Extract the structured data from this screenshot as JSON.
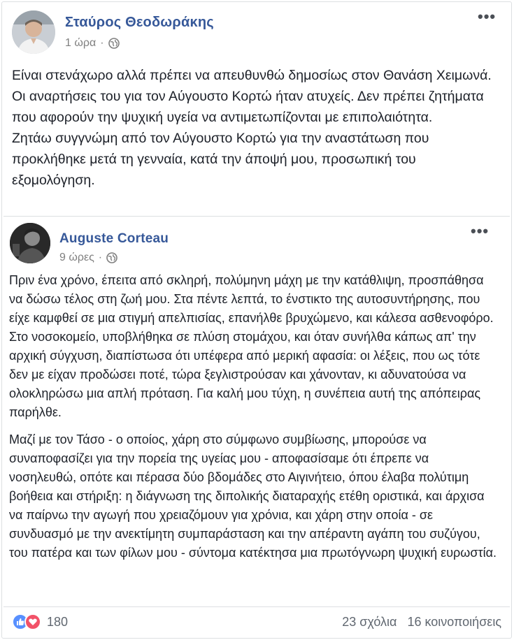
{
  "outer_post": {
    "author": "Σταύρος Θεοδωράκης",
    "time": "1 ώρα",
    "paragraphs": [
      "Είναι στενάχωρο αλλά πρέπει να απευθυνθώ δημοσίως στον Θανάση Χειμωνά. Οι αναρτήσεις του για τον Αύγουστο Κορτώ ήταν ατυχείς. Δεν πρέπει ζητήματα που αφορούν την ψυχική υγεία να αντιμετωπίζονται με επιπολαιότητα.",
      "Ζητάω συγγνώμη από τον Αύγουστο Κορτώ για την αναστάτωση που προκλήθηκε μετά τη γενναία, κατά την άποψή μου, προσωπική του εξομολόγηση."
    ]
  },
  "shared_post": {
    "author": "Auguste Corteau",
    "time": "9 ώρες",
    "paragraphs": [
      "Πριν ένα χρόνο, έπειτα από σκληρή, πολύμηνη μάχη με την κατάθλιψη, προσπάθησα να δώσω τέλος στη ζωή μου. Στα πέντε λεπτά, το ένστικτο της αυτοσυντήρησης, που είχε καμφθεί σε μια στιγμή απελπισίας, επανήλθε βρυχώμενο, και κάλεσα ασθενοφόρο. Στο νοσοκομείο, υποβλήθηκα σε πλύση στομάχου, και όταν συνήλθα κάπως απ' την αρχική σύγχυση, διαπίστωσα ότι υπέφερα από μερική αφασία: οι λέξεις, που ως τότε δεν με είχαν προδώσει ποτέ, τώρα ξεγλιστρούσαν και χάνονταν, κι αδυνατούσα να ολοκληρώσω μια απλή πρόταση. Για καλή μου τύχη, η συνέπεια αυτή της απόπειρας παρήλθε.",
      "Μαζί με τον Τάσο - ο οποίος, χάρη στο σύμφωνο συμβίωσης, μπορούσε να συναποφασίζει για την πορεία της υγείας μου - αποφασίσαμε ότι έπρεπε να νοσηλευθώ, οπότε και πέρασα δύο βδομάδες στο Αιγινήτειο, όπου έλαβα πολύτιμη βοήθεια και στήριξη: η διάγνωση της διπολικής διαταραχής ετέθη οριστικά, και άρχισα να παίρνω την αγωγή που χρειαζόμουν για χρόνια, και χάρη στην οποία - σε συνδυασμό με την ανεκτίμητη συμπαράσταση και την απέραντη αγάπη του συζύγου, του πατέρα και των φίλων μου - σύντομα κατέκτησα μια πρωτόγνωρη ψυχική ευρωστία."
    ]
  },
  "footer": {
    "reaction_count": "180",
    "comments": "23 σχόλια",
    "shares": "16 κοινοποιήσεις"
  },
  "icons": {
    "more": "more-options-icon",
    "globe": "globe-icon",
    "like": "like-reaction-icon",
    "love": "love-reaction-icon"
  },
  "colors": {
    "author_link": "#365899",
    "like": "#5890ff",
    "love": "#f25268"
  }
}
